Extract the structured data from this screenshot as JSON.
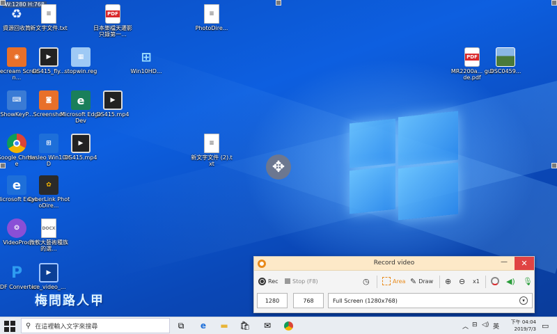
{
  "desktop": {
    "size_tip": "W:1280 H:768",
    "icons": [
      {
        "label": "資源回收筒",
        "kind": "recycle"
      },
      {
        "label": "新文字文件.txt",
        "kind": "doc"
      },
      {
        "label": "日本樂檔天遷影只錄第一...",
        "kind": "pdf"
      },
      {
        "label": "PhotoDire...",
        "kind": "doc"
      },
      {
        "label": "Icecream Screen...",
        "kind": "app"
      },
      {
        "label": "DS415_fly...",
        "kind": "film"
      },
      {
        "label": "stopwin.reg",
        "kind": "reg"
      },
      {
        "label": "Win10HD...",
        "kind": "win"
      },
      {
        "label": "MR2200a... guide.pdf",
        "kind": "pdf"
      },
      {
        "label": "DSC0459...",
        "kind": "photo"
      },
      {
        "label": "ShowKeyP...",
        "kind": "keys"
      },
      {
        "label": "Screenshot",
        "kind": "camera"
      },
      {
        "label": "Microsoft Edge Dev",
        "kind": "edgedev"
      },
      {
        "label": "DS415.mp4",
        "kind": "film"
      },
      {
        "label": "Google Chrome",
        "kind": "chrome"
      },
      {
        "label": "Hasleo Win10HD",
        "kind": "win"
      },
      {
        "label": "DS415.mp4",
        "kind": "film"
      },
      {
        "label": "新文字文件 (2).txt",
        "kind": "doc"
      },
      {
        "label": "Microsoft Edge",
        "kind": "edge"
      },
      {
        "label": "CyberLink PhotoDire...",
        "kind": "cyber"
      },
      {
        "label": "VideoProc",
        "kind": "videoproc"
      },
      {
        "label": "微軟大藝術種族的選...",
        "kind": "docx"
      },
      {
        "label": "PDF Converter",
        "kind": "pdfconv"
      },
      {
        "label": "ice_video_...",
        "kind": "video"
      }
    ],
    "pdf_badge": "PDF",
    "docx_badge": "DOCX",
    "watermark": "梅問路人甲"
  },
  "recorder": {
    "title": "Record video",
    "minimize": "—",
    "close": "✕",
    "rec_label": "Rec",
    "stop_label": "Stop (F8)",
    "area_label": "Area",
    "draw_label": "Draw",
    "zoom_label": "x1",
    "width_value": "1280",
    "height_value": "768",
    "mode_value": "Full Screen (1280x768)",
    "colors": {
      "accent": "#e88a1a",
      "close": "#e04343",
      "title_bg": "#fde9c8"
    }
  },
  "taskbar": {
    "search_placeholder": "在這裡輸入文字來搜尋",
    "ime": "英",
    "time": "下午 04:04",
    "date": "2019/7/3"
  }
}
